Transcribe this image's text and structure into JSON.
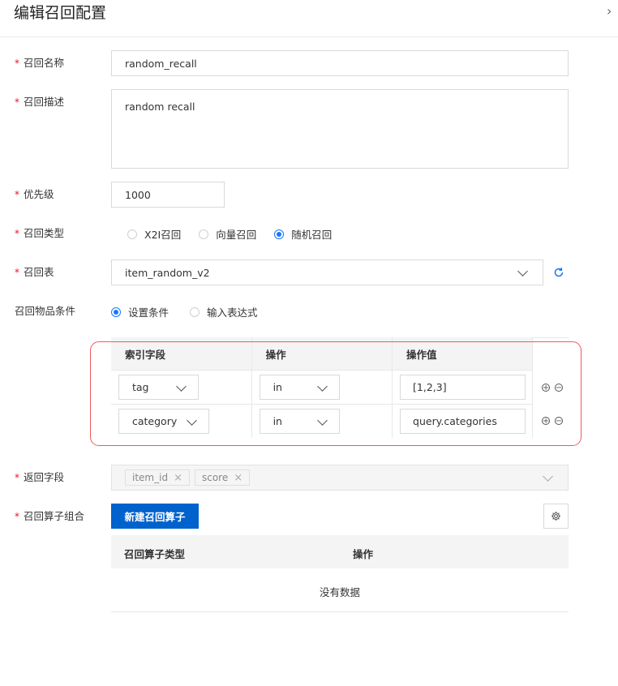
{
  "dialog": {
    "title": "编辑召回配置",
    "close_symbol": "›"
  },
  "form": {
    "name": {
      "label": "召回名称",
      "value": "random_recall"
    },
    "description": {
      "label": "召回描述",
      "value": "random recall"
    },
    "priority": {
      "label": "优先级",
      "value": "1000"
    },
    "type": {
      "label": "召回类型",
      "options": [
        "X2I召回",
        "向量召回",
        "随机召回"
      ],
      "selected": "随机召回"
    },
    "table": {
      "label": "召回表",
      "value": "item_random_v2"
    },
    "conditions": {
      "label": "召回物品条件",
      "modes": [
        "设置条件",
        "输入表达式"
      ],
      "selected_mode": "设置条件",
      "columns": [
        "索引字段",
        "操作",
        "操作值"
      ],
      "rows": [
        {
          "field": "tag",
          "op": "in",
          "value": "[1,2,3]"
        },
        {
          "field": "category",
          "op": "in",
          "value": "query.categories"
        }
      ]
    },
    "return_fields": {
      "label": "返回字段",
      "tags": [
        "item_id",
        "score"
      ]
    },
    "operators": {
      "label": "召回算子组合",
      "new_button": "新建召回算子",
      "columns": [
        "召回算子类型",
        "操作"
      ],
      "empty_text": "没有数据"
    }
  },
  "colors": {
    "primary": "#0062cc",
    "radio_active": "#1677ff",
    "required": "#e8112d",
    "highlight_box": "#ec5b5b"
  }
}
